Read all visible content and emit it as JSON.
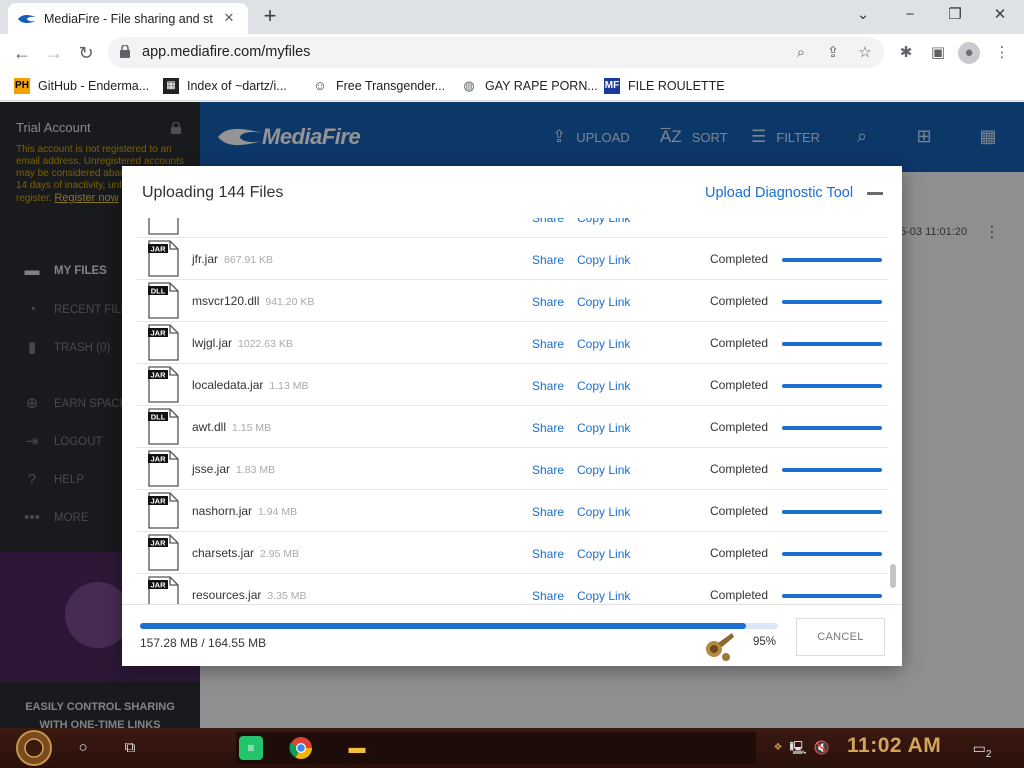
{
  "browser": {
    "tab_title": "MediaFire - File sharing and st",
    "url": "app.mediafire.com/myfiles",
    "bookmarks": [
      {
        "label": "GitHub - Enderma...",
        "icon": "ph-icon"
      },
      {
        "label": "Index of ~dartz/i...",
        "icon": "site-icon"
      },
      {
        "label": "Free Transgender...",
        "icon": "mask-icon"
      },
      {
        "label": "GAY RAPE PORN...",
        "icon": "globe-icon"
      },
      {
        "label": "FILE ROULETTE",
        "icon": "file-roulette-icon"
      }
    ]
  },
  "sidebar": {
    "account_title": "Trial Account",
    "warning": "This account is not registered to an email address. Unregistered accounts may be considered abandoned after 14 days of inactivity, unless you register.",
    "register_link": "Register now",
    "items": [
      {
        "label": "MY FILES",
        "icon": "folder-icon",
        "active": true
      },
      {
        "label": "RECENT FILES",
        "icon": "recent-icon"
      },
      {
        "label": "TRASH (0)",
        "icon": "trash-icon"
      },
      {
        "label": "EARN SPACE",
        "icon": "plus-circle-icon"
      },
      {
        "label": "LOGOUT",
        "icon": "logout-icon"
      },
      {
        "label": "HELP",
        "icon": "help-icon"
      },
      {
        "label": "MORE",
        "icon": "more-icon"
      }
    ],
    "promo_line1": "EASILY CONTROL SHARING",
    "promo_line2": "WITH ONE-TIME LINKS"
  },
  "topbar": {
    "logo": "MediaFire",
    "upload": "UPLOAD",
    "sort": "SORT",
    "filter": "FILTER"
  },
  "background": {
    "date": "5-03 11:01:20"
  },
  "modal": {
    "title": "Uploading 144 Files",
    "diagnostic": "Upload Diagnostic Tool",
    "share_label": "Share",
    "copy_label": "Copy Link",
    "files": [
      {
        "name": "jfr.jar",
        "size": "867.91 KB",
        "type": "JAR",
        "status": "Completed",
        "progress": 1.0
      },
      {
        "name": "msvcr120.dll",
        "size": "941.20 KB",
        "type": "DLL",
        "status": "Completed",
        "progress": 1.0
      },
      {
        "name": "lwjgl.jar",
        "size": "1022.63 KB",
        "type": "JAR",
        "status": "Completed",
        "progress": 1.0
      },
      {
        "name": "localedata.jar",
        "size": "1.13 MB",
        "type": "JAR",
        "status": "Completed",
        "progress": 1.0
      },
      {
        "name": "awt.dll",
        "size": "1.15 MB",
        "type": "DLL",
        "status": "Completed",
        "progress": 1.0
      },
      {
        "name": "jsse.jar",
        "size": "1.83 MB",
        "type": "JAR",
        "status": "Completed",
        "progress": 1.0
      },
      {
        "name": "nashorn.jar",
        "size": "1.94 MB",
        "type": "JAR",
        "status": "Completed",
        "progress": 1.0
      },
      {
        "name": "charsets.jar",
        "size": "2.95 MB",
        "type": "JAR",
        "status": "Completed",
        "progress": 1.0
      },
      {
        "name": "resources.jar",
        "size": "3.35 MB",
        "type": "JAR",
        "status": "Completed",
        "progress": 1.0
      }
    ],
    "total": "157.28 MB / 164.55 MB",
    "percent": "95%",
    "progress": 0.95,
    "cancel": "CANCEL"
  },
  "taskbar": {
    "clock": "11:02 AM",
    "notifications": "2"
  },
  "colors": {
    "brand_blue": "#1560b5",
    "link_blue": "#1a6fd0",
    "warning_yellow": "#d4a600"
  }
}
